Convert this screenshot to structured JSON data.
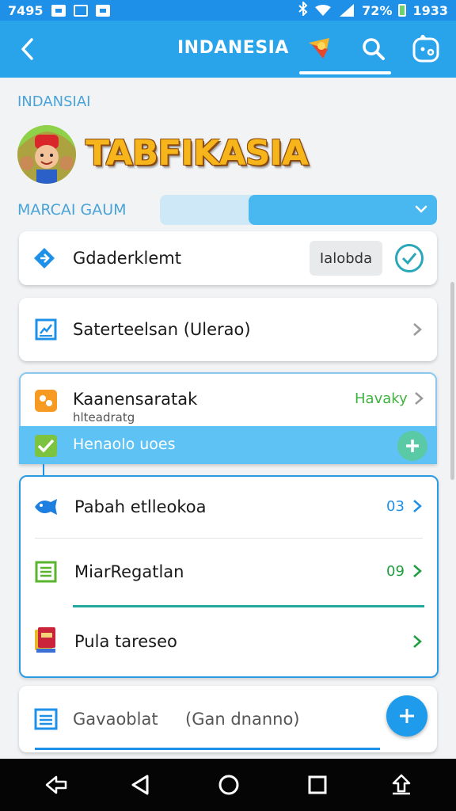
{
  "status_bar": {
    "time": "7495",
    "battery": "72%",
    "clock": "1933"
  },
  "app_bar": {
    "title": "INDANESIA"
  },
  "section_label": "INDANSIAI",
  "brand": {
    "name": "TABFIKASIA"
  },
  "progress": {
    "label": "MARCAI GAUM",
    "fill_fraction": 0.68
  },
  "cards": {
    "first": {
      "title": "Gdaderklemt",
      "tag": "Ialobda"
    },
    "second": {
      "title": "Saterteelsan (Ulerao)"
    },
    "third": {
      "title": "Kaanensaratak",
      "subtitle": "hlteadratg",
      "status": "Havaky",
      "status_color": "#3fb23f"
    },
    "highlight": {
      "text": "Henaolo uoes"
    }
  },
  "group": {
    "items": [
      {
        "title": "Pabah etlleokoa",
        "count": "03",
        "count_color": "#1e90e8"
      },
      {
        "title": "MiarRegatlan",
        "count": "09",
        "count_color": "#1f9e3f"
      },
      {
        "title": "Pula tareseo",
        "count": ""
      }
    ]
  },
  "last_card": {
    "title": "Gavaoblat",
    "subtitle": "(Gan dnanno)"
  },
  "colors": {
    "accent": "#29a3ea",
    "primary": "#1e90e8",
    "teal": "#24a7a0"
  }
}
